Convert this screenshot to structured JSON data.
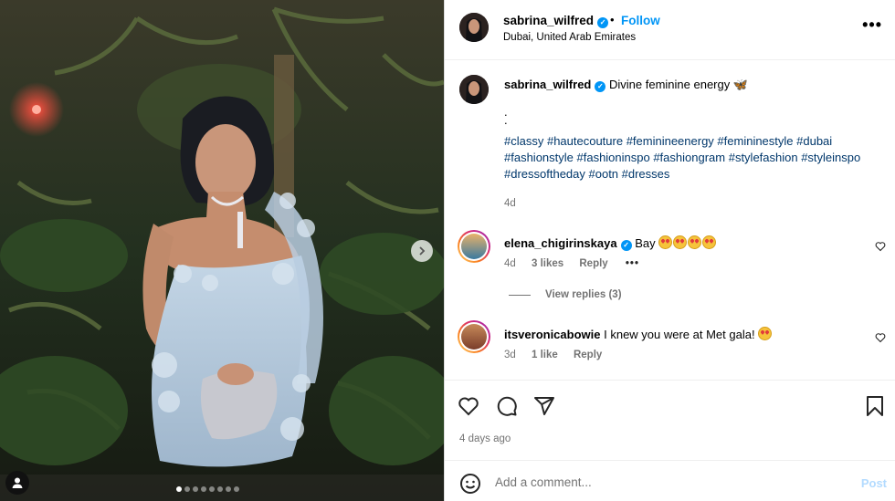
{
  "post": {
    "username": "sabrina_wilfred",
    "follow_label": "Follow",
    "separator": "•",
    "location": "Dubai, United Arab Emirates",
    "more_label": "•••",
    "caption_text": "Divine feminine energy 🦋",
    "caption_dots": [
      ".",
      "."
    ],
    "hashtags": "#classy #hautecouture #feminineenergy #femininestyle #dubai #fashionstyle #fashioninspo #fashiongram #stylefashion #styleinspo #dressoftheday #ootn #dresses",
    "caption_age": "4d",
    "carousel": {
      "count": 8,
      "active_index": 0
    }
  },
  "comments": [
    {
      "username": "elena_chigirinskaya",
      "verified": true,
      "text": "Bay",
      "emoji_count": 4,
      "age": "4d",
      "likes": "3 likes",
      "reply_label": "Reply",
      "more_label": "•••",
      "view_replies": "View replies (3)"
    },
    {
      "username": "itsveronicabowie",
      "verified": false,
      "text": "I knew you were at Met gala!",
      "emoji_count": 1,
      "age": "3d",
      "likes": "1 like",
      "reply_label": "Reply"
    }
  ],
  "footer": {
    "post_age": "4 days ago",
    "comment_placeholder": "Add a comment...",
    "post_label": "Post"
  },
  "icons": [
    "heart-icon",
    "comment-icon",
    "share-icon",
    "bookmark-icon",
    "emoji-icon",
    "verified-icon",
    "tag-user-icon",
    "chevron-right-icon"
  ],
  "colors": {
    "accent": "#0095f6",
    "link": "#00376b",
    "muted": "#737373",
    "post_disabled": "#b3dbff"
  }
}
